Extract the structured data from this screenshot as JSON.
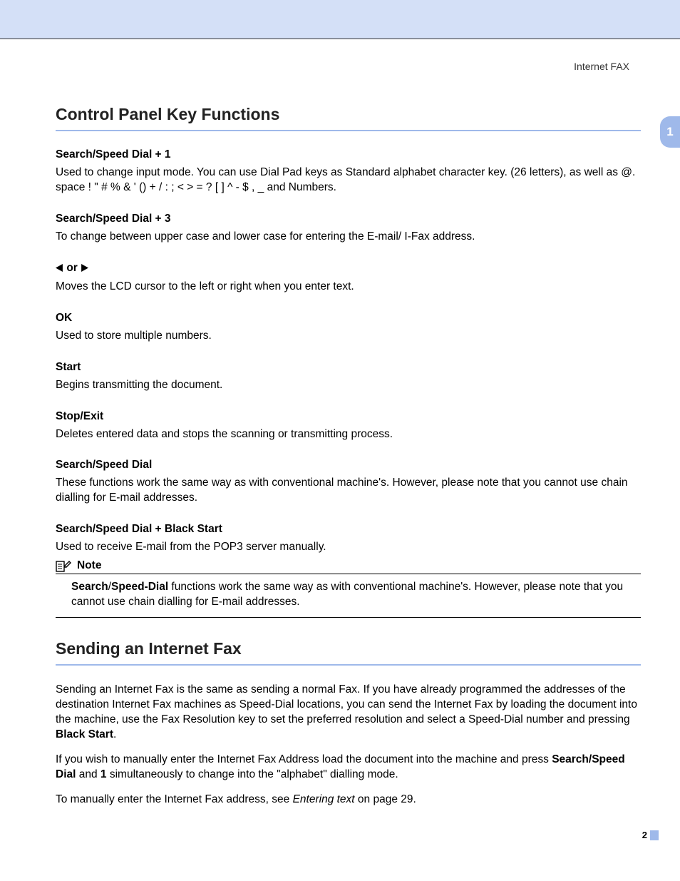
{
  "header": {
    "doc_section": "Internet FAX"
  },
  "side_tab": "1",
  "section1": {
    "title": "Control Panel Key Functions",
    "items": [
      {
        "head": "Search/Speed Dial + 1",
        "body": "Used to change input mode. You can use Dial Pad keys as Standard alphabet character key. (26 letters), as well as @. space ! \" # % & ' () + / : ; < > = ? [ ] ^ - $ , _  and Numbers."
      },
      {
        "head": "Search/Speed Dial + 3",
        "body": "To change between upper case and lower case for entering the E-mail/ I-Fax address."
      },
      {
        "head": "◀ or ▶",
        "body": "Moves the LCD cursor to the left or right when you enter text."
      },
      {
        "head": "OK",
        "body": "Used to store multiple numbers."
      },
      {
        "head": "Start",
        "body": "Begins transmitting the document."
      },
      {
        "head": "Stop/Exit",
        "body": "Deletes entered data and stops the scanning or transmitting process."
      },
      {
        "head": "Search/Speed Dial",
        "body": "These functions work the same way as with conventional machine's. However, please note that you cannot use chain dialling for E-mail addresses."
      },
      {
        "head": "Search/Speed Dial + Black Start",
        "body": "Used to receive E-mail from the POP3 server manually."
      }
    ],
    "note": {
      "label": "Note",
      "body_pre_bold1": "Search",
      "body_sep": "/",
      "body_bold2": "Speed-Dial",
      "body_rest": " functions work the same way as with conventional machine's. However, please note that you cannot use chain dialling for E-mail addresses."
    }
  },
  "section2": {
    "title": "Sending an Internet Fax",
    "p1_pre": "Sending an Internet Fax is the same as sending a normal Fax. If you have already programmed the addresses of the destination Internet Fax machines as Speed-Dial locations, you can send the Internet Fax by loading the document into the machine, use the Fax Resolution key to set the preferred resolution and select a Speed-Dial number and pressing ",
    "p1_bold": "Black Start",
    "p1_post": ".",
    "p2_pre": "If you wish to manually enter the Internet Fax Address load the document into the machine and press ",
    "p2_b1": "Search/Speed Dial",
    "p2_mid1": " and ",
    "p2_b2": "1",
    "p2_post": " simultaneously to change into the \"alphabet\" dialling mode.",
    "p3_pre": "To manually enter the Internet Fax address, see ",
    "p3_italic": "Entering text",
    "p3_post": " on page 29."
  },
  "page_number": "2"
}
